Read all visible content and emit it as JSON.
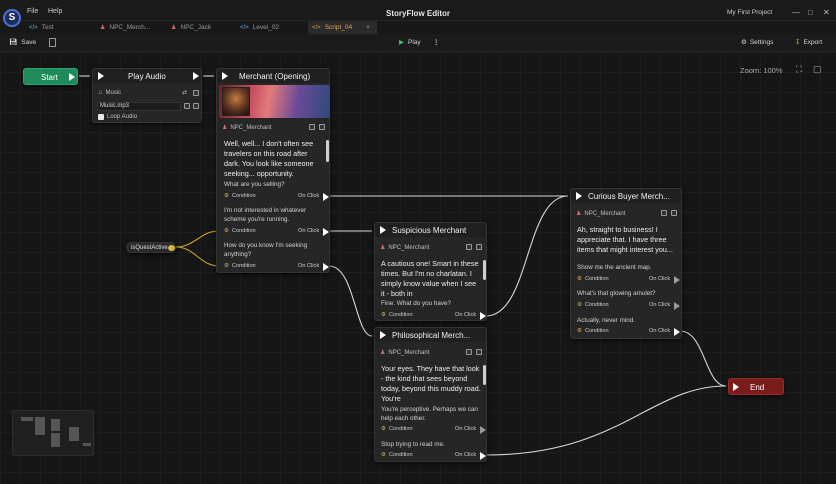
{
  "app": {
    "title": "StoryFlow Editor",
    "menu": [
      "File",
      "Help"
    ],
    "project": "My First Project"
  },
  "tabs": [
    {
      "label": "Test",
      "icon": "code-icon"
    },
    {
      "label": "NPC_Merch...",
      "icon": "person-icon"
    },
    {
      "label": "NPC_Jack",
      "icon": "person-icon"
    },
    {
      "label": "Level_02",
      "icon": "code-icon"
    },
    {
      "label": "Script_04",
      "icon": "code-icon",
      "close": "×"
    }
  ],
  "toolbar": {
    "save": "Save",
    "play": "Play",
    "settings": "Settings",
    "export": "Export"
  },
  "zoom": "Zoom: 100%",
  "colors": {
    "accent": "#e5a55a",
    "start": "#1f8a5a",
    "end": "#7a1c1c",
    "wire": "#d8d8d8",
    "condition_wire": "#c9a630"
  },
  "nodes": {
    "start": {
      "label": "Start"
    },
    "play_audio": {
      "title": "Play Audio",
      "type_label": "Music",
      "file": "Music.mp3",
      "loop": "Loop Audio"
    },
    "merchant_opening": {
      "title": "Merchant (Opening)",
      "character": "NPC_Merchant",
      "text": "Well, well... I don't often see travelers on this road after dark. You look like someone seeking... opportunity.",
      "options": [
        {
          "text": "What are you selling?",
          "condition": "Condition",
          "click": "On Click"
        },
        {
          "text": "I'm not interested in whatever scheme you're running.",
          "condition": "Condition",
          "click": "On Click"
        },
        {
          "text": "How do you know I'm seeking anything?",
          "condition": "Condition",
          "click": "On Click"
        }
      ]
    },
    "is_quest_active": {
      "label": "isQuestActive"
    },
    "suspicious": {
      "title": "Suspicious Merchant",
      "character": "NPC_Merchant",
      "text": "A cautious one! Smart in these times. But I'm no charlatan. I simply know value when I see it - both in",
      "options": [
        {
          "text": "Fine. What do you have?",
          "condition": "Condition",
          "click": "On Click"
        }
      ]
    },
    "philosophical": {
      "title": "Philosophical Merch...",
      "character": "NPC_Merchant",
      "text": "Your eyes. They have that look - the kind that sees beyond today, beyond this muddy road. You're",
      "options": [
        {
          "text": "You're perceptive. Perhaps we can help each other.",
          "condition": "Condition",
          "click": "On Click"
        },
        {
          "text": "Stop trying to read me.",
          "condition": "Condition",
          "click": "On Click"
        }
      ]
    },
    "curious": {
      "title": "Curious Buyer Merch...",
      "character": "NPC_Merchant",
      "text": "Ah, straight to business! I appreciate that. I have three items that might interest you...",
      "options": [
        {
          "text": "Show me the ancient map.",
          "condition": "Condition",
          "click": "On Click"
        },
        {
          "text": "What's that glowing amulet?",
          "condition": "Condition",
          "click": "On Click"
        },
        {
          "text": "Actually, never mind.",
          "condition": "Condition",
          "click": "On Click"
        }
      ]
    },
    "end": {
      "label": "End"
    }
  }
}
